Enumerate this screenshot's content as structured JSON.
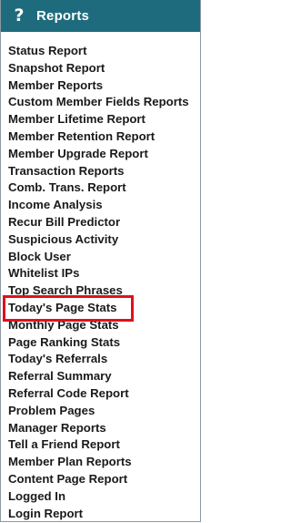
{
  "header": {
    "icon": "question-mark-icon",
    "icon_glyph": "?",
    "title": "Reports",
    "background_color": "#1f6b7e"
  },
  "menu": {
    "items": [
      {
        "label": "Status Report"
      },
      {
        "label": "Snapshot Report"
      },
      {
        "label": "Member Reports"
      },
      {
        "label": "Custom Member Fields Reports"
      },
      {
        "label": "Member Lifetime Report"
      },
      {
        "label": "Member Retention Report"
      },
      {
        "label": "Member Upgrade Report"
      },
      {
        "label": "Transaction Reports"
      },
      {
        "label": "Comb. Trans. Report"
      },
      {
        "label": "Income Analysis"
      },
      {
        "label": "Recur Bill Predictor"
      },
      {
        "label": "Suspicious Activity"
      },
      {
        "label": "Block User"
      },
      {
        "label": "Whitelist IPs"
      },
      {
        "label": "Top Search Phrases"
      },
      {
        "label": "Today's Page Stats",
        "highlighted": true
      },
      {
        "label": "Monthly Page Stats"
      },
      {
        "label": "Page Ranking Stats"
      },
      {
        "label": "Today's Referrals"
      },
      {
        "label": "Referral Summary"
      },
      {
        "label": "Referral Code Report"
      },
      {
        "label": "Problem Pages"
      },
      {
        "label": "Manager Reports"
      },
      {
        "label": "Tell a Friend Report"
      },
      {
        "label": "Member Plan Reports"
      },
      {
        "label": "Content Page Report"
      },
      {
        "label": "Logged In"
      },
      {
        "label": "Login Report"
      }
    ],
    "highlight_color": "#e0101a"
  }
}
